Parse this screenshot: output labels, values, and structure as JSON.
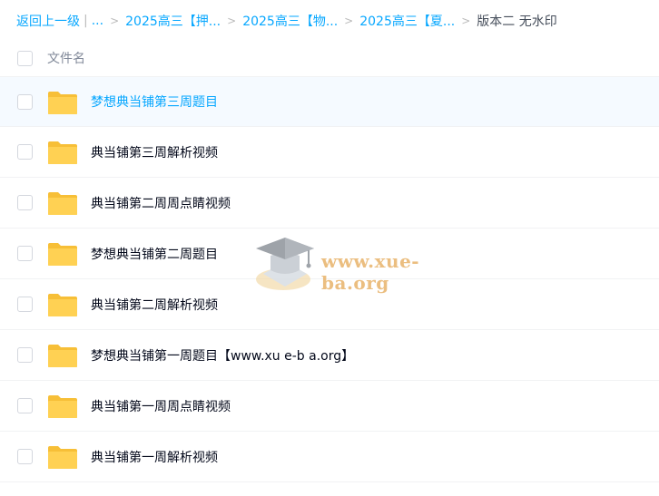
{
  "breadcrumb": {
    "back_label": "返回上一级",
    "divider": "|",
    "ellipsis": "...",
    "separator": ">",
    "crumbs": [
      "2025高三【押...",
      "2025高三【物...",
      "2025高三【夏..."
    ],
    "current": "版本二 无水印"
  },
  "header": {
    "column_label": "文件名"
  },
  "files": [
    {
      "name": "梦想典当铺第三周题目",
      "hovered": true
    },
    {
      "name": "典当铺第三周解析视频"
    },
    {
      "name": "典当铺第二周周点睛视频"
    },
    {
      "name": "梦想典当铺第二周题目"
    },
    {
      "name": "典当铺第二周解析视频"
    },
    {
      "name": "梦想典当铺第一周题目【www.xu e-b a.org】"
    },
    {
      "name": "典当铺第一周周点睛视频"
    },
    {
      "name": "典当铺第一周解析视频"
    }
  ],
  "watermark": {
    "text": "www.xue-ba.org",
    "icon": "graduation-cap-icon"
  },
  "colors": {
    "link": "#06a7ff",
    "folder": "#ffd153",
    "folder_back": "#f7bf37",
    "hover_bg": "#f5faff"
  }
}
